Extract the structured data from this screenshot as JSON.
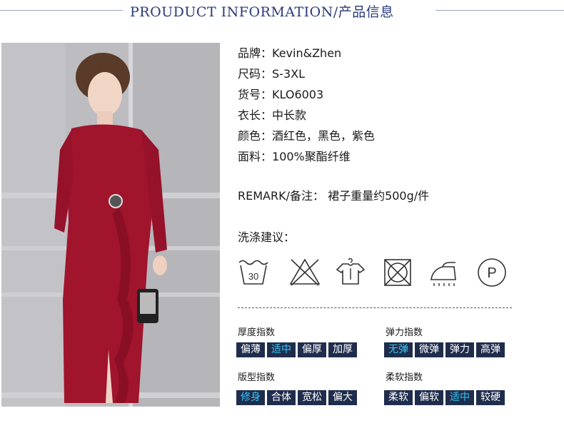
{
  "header": {
    "title": "PROUDUCT INFORMATION/产品信息"
  },
  "info": {
    "rows": [
      {
        "label": "品牌：",
        "value": "Kevin&Zhen"
      },
      {
        "label": "尺码：",
        "value": "S-3XL"
      },
      {
        "label": "货号：",
        "value": "KLO6003"
      },
      {
        "label": "衣长：",
        "value": "中长款"
      },
      {
        "label": "颜色：",
        "value": "酒红色，黑色，紫色"
      },
      {
        "label": "面料：",
        "value": "100%聚酯纤维"
      }
    ],
    "remark": "REMARK/备注：  裙子重量约500g/件",
    "wash_title": "洗涤建议：",
    "care_icons": [
      "wash-30-icon",
      "no-bleach-icon",
      "hang-dry-icon",
      "no-tumble-dry-icon",
      "iron-icon",
      "professional-dry-clean-icon"
    ],
    "wash_temp": "30",
    "dry_clean_letter": "P"
  },
  "indices": {
    "thickness": {
      "title": "厚度指数",
      "options": [
        "偏薄",
        "适中",
        "偏厚",
        "加厚"
      ],
      "active": 1
    },
    "elasticity": {
      "title": "弹力指数",
      "options": [
        "无弹",
        "微弹",
        "弹力",
        "高弹"
      ],
      "active": 0
    },
    "fit": {
      "title": "版型指数",
      "options": [
        "修身",
        "合体",
        "宽松",
        "偏大"
      ],
      "active": 0
    },
    "softness": {
      "title": "柔软指数",
      "options": [
        "柔软",
        "偏软",
        "适中",
        "较硬"
      ],
      "active": 2
    }
  },
  "colors": {
    "accent": "#35c6f4",
    "tag_bg": "#1f2d4d",
    "title_blue": "#2b3a7a",
    "dress_red": "#a0142c"
  }
}
